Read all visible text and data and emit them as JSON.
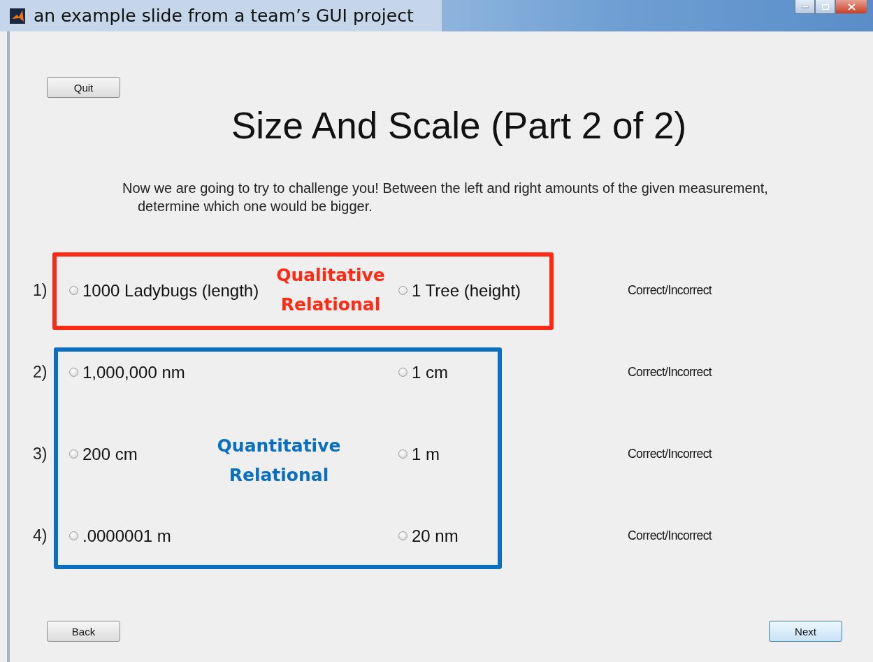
{
  "window": {
    "title": "an example slide from a team’s GUI project"
  },
  "quit_button": "Quit",
  "heading": "Size And Scale (Part 2 of 2)",
  "instructions": "Now we are going to try to challenge you! Between the left and right amounts of the given measurement,\ndetermine which one would be bigger.",
  "questions": [
    {
      "number": "1)",
      "left": {
        "label": "1000 Ladybugs (length)",
        "selected": false
      },
      "right": {
        "label": "1 Tree (height)",
        "selected": false
      },
      "feedback": "Correct/Incorrect"
    },
    {
      "number": "2)",
      "left": {
        "label": "1,000,000 nm",
        "selected": false
      },
      "right": {
        "label": "1 cm",
        "selected": false
      },
      "feedback": "Correct/Incorrect"
    },
    {
      "number": "3)",
      "left": {
        "label": "200 cm",
        "selected": false
      },
      "right": {
        "label": "1 m",
        "selected": false
      },
      "feedback": "Correct/Incorrect"
    },
    {
      "number": "4)",
      "left": {
        "label": ".0000001 m",
        "selected": false
      },
      "right": {
        "label": "20 nm",
        "selected": false
      },
      "feedback": "Correct/Incorrect"
    }
  ],
  "annotations": [
    {
      "label": "Qualitative Relational",
      "color": "#ff2a14"
    },
    {
      "label": "Quantitative Relational",
      "color": "#0b6fc1"
    }
  ],
  "back_button": "Back",
  "next_button": "Next"
}
